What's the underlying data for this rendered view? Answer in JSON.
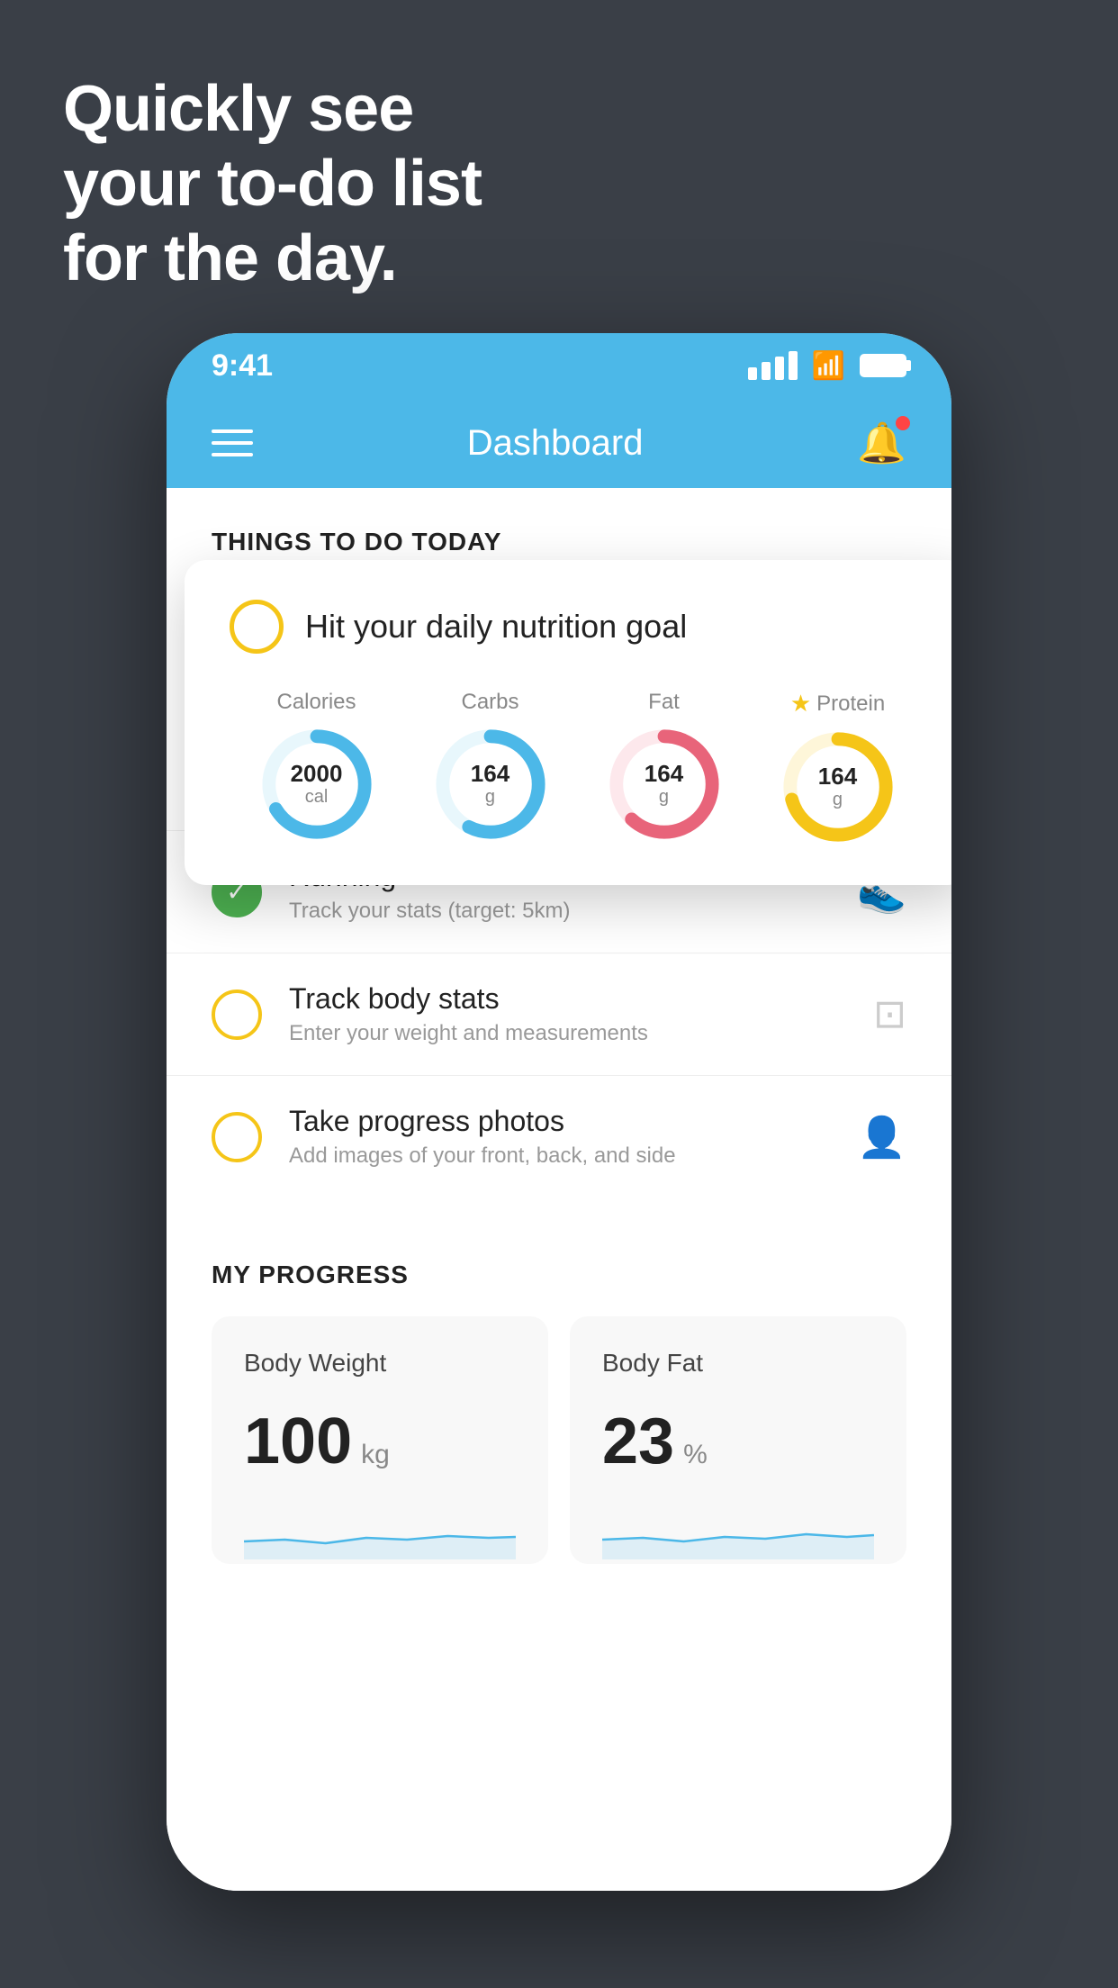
{
  "background_color": "#3a3f47",
  "headline": {
    "line1": "Quickly see",
    "line2": "your to-do list",
    "line3": "for the day."
  },
  "status_bar": {
    "time": "9:41",
    "signal": "signal",
    "wifi": "wifi",
    "battery": "battery"
  },
  "header": {
    "title": "Dashboard",
    "menu_icon": "hamburger",
    "notification_icon": "bell"
  },
  "things_to_do": {
    "section_label": "THINGS TO DO TODAY",
    "nutrition_card": {
      "title": "Hit your daily nutrition goal",
      "macros": [
        {
          "label": "Calories",
          "value": "2000",
          "unit": "cal",
          "color": "#4cb8e8",
          "highlight": false
        },
        {
          "label": "Carbs",
          "value": "164",
          "unit": "g",
          "color": "#4cb8e8",
          "highlight": false
        },
        {
          "label": "Fat",
          "value": "164",
          "unit": "g",
          "color": "#e8647a",
          "highlight": false
        },
        {
          "label": "Protein",
          "value": "164",
          "unit": "g",
          "color": "#f5c518",
          "highlight": true
        }
      ]
    },
    "todo_items": [
      {
        "title": "Running",
        "subtitle": "Track your stats (target: 5km)",
        "circle_color": "green",
        "icon": "shoe"
      },
      {
        "title": "Track body stats",
        "subtitle": "Enter your weight and measurements",
        "circle_color": "yellow",
        "icon": "scale"
      },
      {
        "title": "Take progress photos",
        "subtitle": "Add images of your front, back, and side",
        "circle_color": "yellow",
        "icon": "person"
      }
    ]
  },
  "my_progress": {
    "section_label": "MY PROGRESS",
    "cards": [
      {
        "title": "Body Weight",
        "value": "100",
        "unit": "kg"
      },
      {
        "title": "Body Fat",
        "value": "23",
        "unit": "%"
      }
    ]
  }
}
